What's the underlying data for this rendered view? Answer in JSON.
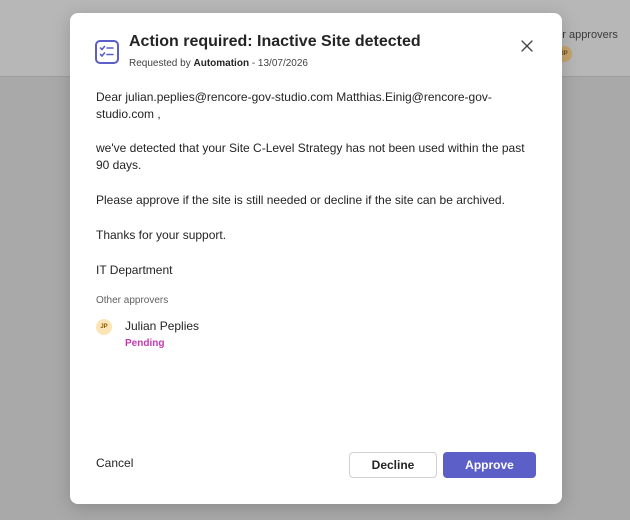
{
  "background": {
    "approvers_label": "ner approvers",
    "avatar_initials": "JP"
  },
  "dialog": {
    "icon": "task-checklist-icon",
    "title": "Action required: Inactive Site detected",
    "requested_by_prefix": "Requested by",
    "author": "Automation",
    "date": " - 13/07/2026",
    "close_icon": "close-icon",
    "greeting": "Dear julian.peplies@rencore-gov-studio.com Matthias.Einig@rencore-gov-studio.com ,",
    "message": "we've detected that your Site C-Level Strategy has not been used within the past 90 days.",
    "request": "Please approve if the site is still needed or decline if the site can be archived.",
    "thanks": "Thanks for your support.",
    "signature": "IT Department",
    "approvers_label": "Other approvers",
    "approvers": [
      {
        "initials": "JP",
        "name": "Julian Peplies",
        "status": "Pending"
      }
    ],
    "buttons": {
      "cancel": "Cancel",
      "decline": "Decline",
      "approve": "Approve"
    }
  },
  "colors": {
    "accent": "#5b5fc7",
    "pending": "#c239b3"
  }
}
